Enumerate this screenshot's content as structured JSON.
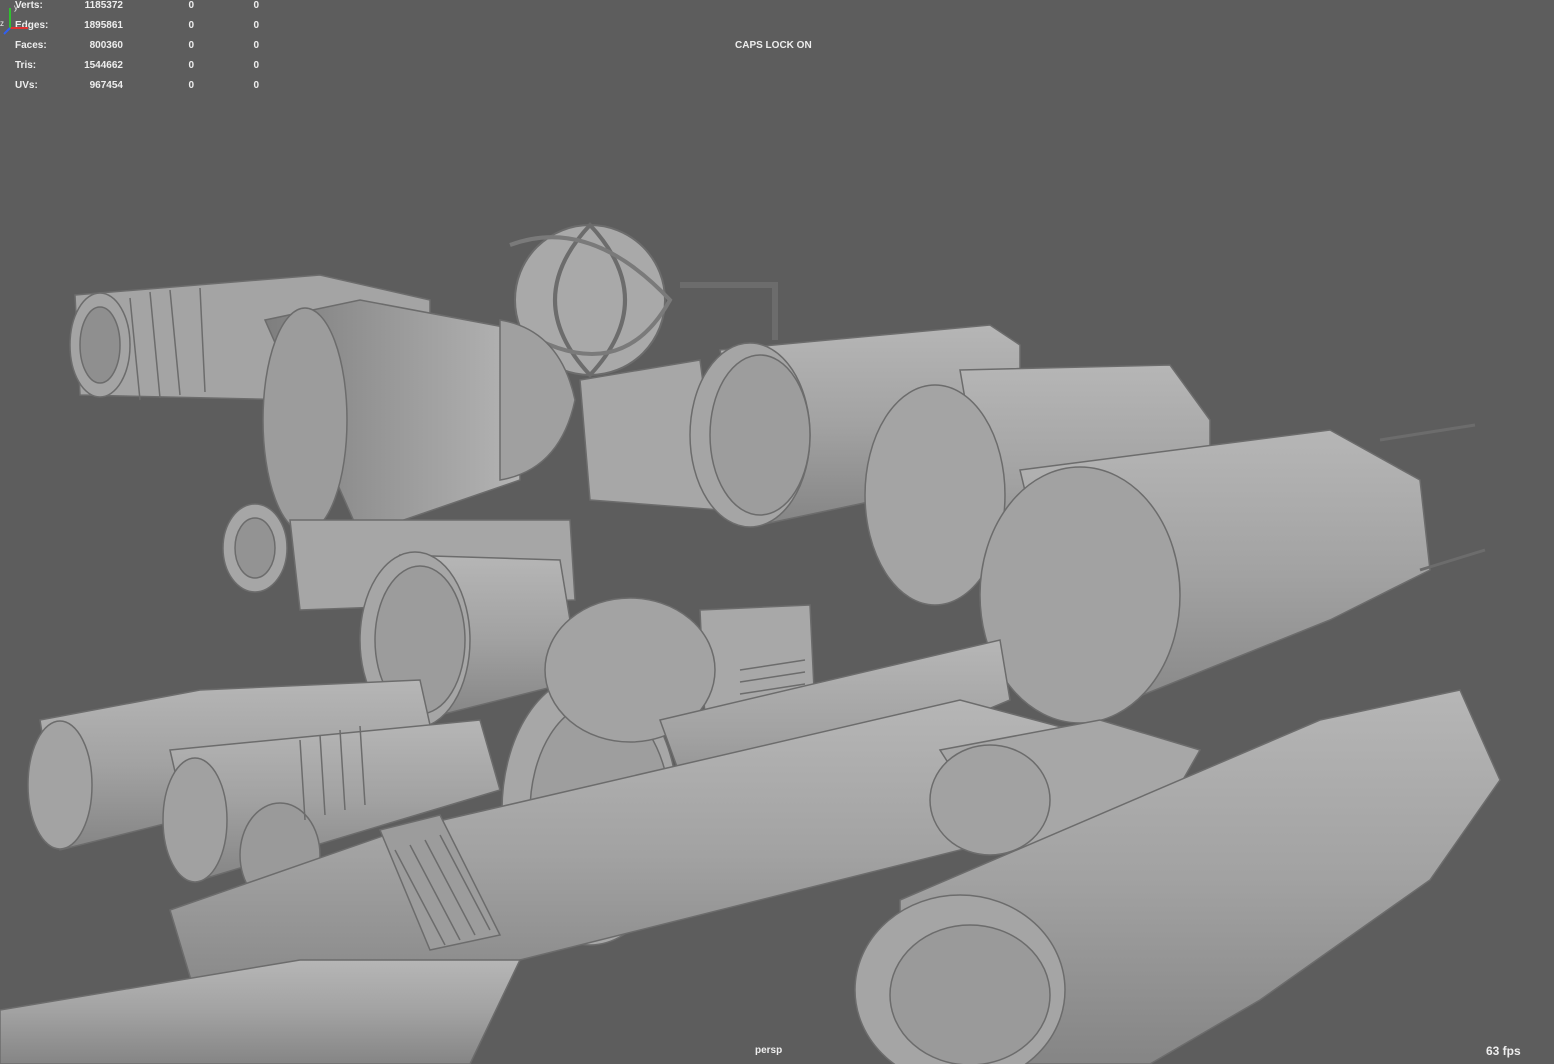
{
  "hud": {
    "rows": [
      {
        "label": "Verts:",
        "total": "1185372",
        "selected": "0",
        "components": "0"
      },
      {
        "label": "Edges:",
        "total": "1895861",
        "selected": "0",
        "components": "0"
      },
      {
        "label": "Faces:",
        "total": "800360",
        "selected": "0",
        "components": "0"
      },
      {
        "label": "Tris:",
        "total": "1544662",
        "selected": "0",
        "components": "0"
      },
      {
        "label": "UVs:",
        "total": "967454",
        "selected": "0",
        "components": "0"
      }
    ]
  },
  "status": {
    "caps_lock": "CAPS LOCK ON",
    "camera": "persp",
    "fps": "63 fps"
  },
  "colors": {
    "background": "#5d5d5d",
    "model": "#a6a6a6",
    "hud_text": "#eeeeee",
    "axis_x": "#e03030",
    "axis_y": "#30c030",
    "axis_z": "#3060f0"
  }
}
